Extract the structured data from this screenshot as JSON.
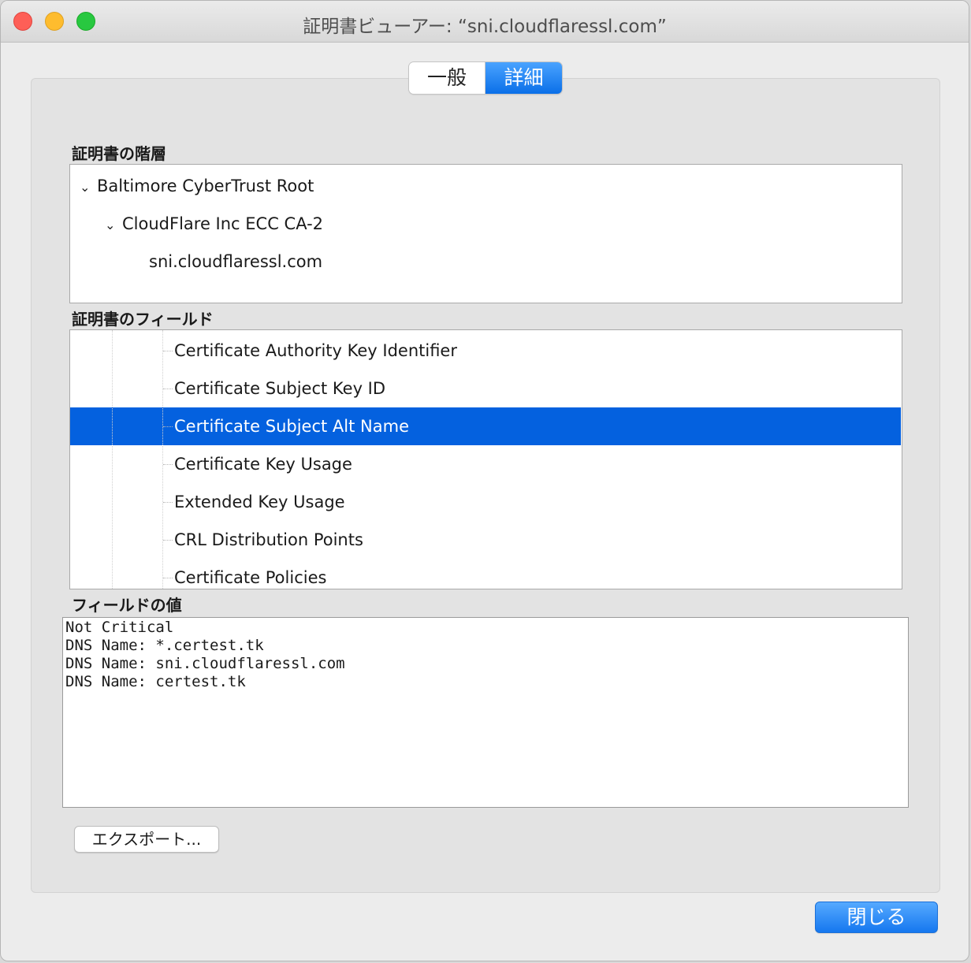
{
  "window": {
    "title": "証明書ビューアー: “sni.cloudflaressl.com”"
  },
  "tabs": [
    {
      "label": "一般",
      "selected": false
    },
    {
      "label": "詳細",
      "selected": true
    }
  ],
  "hierarchy": {
    "label": "証明書の階層",
    "items": [
      {
        "label": "Baltimore CyberTrust Root",
        "expanded": true
      },
      {
        "label": "CloudFlare Inc ECC CA-2",
        "expanded": true
      },
      {
        "label": "sni.cloudflaressl.com"
      }
    ]
  },
  "fields": {
    "label": "証明書のフィールド",
    "items": [
      "Certificate Authority Key Identifier",
      "Certificate Subject Key ID",
      "Certificate Subject Alt Name",
      "Certificate Key Usage",
      "Extended Key Usage",
      "CRL Distribution Points",
      "Certificate Policies"
    ],
    "selected_index": 2
  },
  "value": {
    "label": "フィールドの値",
    "lines": [
      "Not Critical",
      "DNS Name: *.certest.tk",
      "DNS Name: sni.cloudflaressl.com",
      "DNS Name: certest.tk"
    ]
  },
  "buttons": {
    "export": "エクスポート...",
    "close": "閉じる"
  },
  "colors": {
    "selection": "#0461df",
    "accent": "#1577ef"
  }
}
